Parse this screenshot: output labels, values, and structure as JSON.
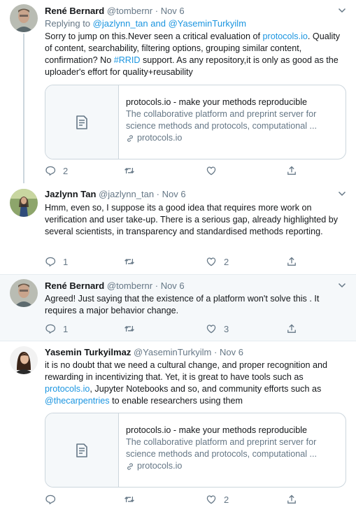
{
  "tweets": [
    {
      "name": "René Bernard",
      "handle": "@tombernr",
      "dot": "·",
      "date": "Nov 6",
      "reply_prefix": "Replying to",
      "reply_users": [
        "@jazlynn_tan",
        "and",
        "@YaseminTurkyilm"
      ],
      "text_parts": [
        "Sorry to jump on this.Never seen a critical evaluation of ",
        "protocols.io",
        ". Quality of content, searchability, filtering options, grouping similar content, confirmation? No ",
        "#RRID",
        " support. As any repository,it is only as good as the uploader's effort for quality+reusability"
      ],
      "card": {
        "title": "protocols.io - make your methods reproducible",
        "desc": "The collaborative platform and preprint server for science methods and protocols, computational ...",
        "domain": "protocols.io"
      },
      "counts": {
        "reply": "2",
        "retweet": "",
        "like": "",
        "share": ""
      }
    },
    {
      "name": "Jazlynn Tan",
      "handle": "@jazlynn_tan",
      "dot": "·",
      "date": "Nov 6",
      "text": "Hmm, even so, I suppose its a good idea that requires more work on verification and user take-up. There is a serious gap, already highlighted by several scientists, in transparency and standardised methods reporting.",
      "counts": {
        "reply": "1",
        "retweet": "",
        "like": "2",
        "share": ""
      }
    },
    {
      "name": "René Bernard",
      "handle": "@tombernr",
      "dot": "·",
      "date": "Nov 6",
      "text": "Agreed! Just saying that the existence of a platform won't solve this . It requires a major behavior change.",
      "counts": {
        "reply": "1",
        "retweet": "",
        "like": "3",
        "share": ""
      }
    },
    {
      "name": "Yasemin Turkyilmaz",
      "handle": "@YaseminTurkyilm",
      "dot": "·",
      "date": "Nov 6",
      "text_parts": [
        "it is no doubt that we need a cultural change, and proper recognition and rewarding in incentivizing that. Yet, it is great to have tools such as ",
        "protocols.io",
        ", Jupyter Notebooks and so, and community efforts such as ",
        "@thecarpentries",
        " to enable researchers using them"
      ],
      "card": {
        "title": "protocols.io - make your methods reproducible",
        "desc": "The collaborative platform and preprint server for science methods and protocols, computational ...",
        "domain": "protocols.io"
      },
      "counts": {
        "reply": "",
        "retweet": "",
        "like": "2",
        "share": ""
      }
    }
  ],
  "colors": {
    "text": "#14171a",
    "secondary": "#657786",
    "link": "#1b95e0",
    "border": "#ccd6dd",
    "highlight_bg": "#f5f8fa"
  },
  "icons": [
    "chevron-down-icon",
    "reply-icon",
    "retweet-icon",
    "like-icon",
    "share-icon",
    "link-icon",
    "document-icon"
  ]
}
